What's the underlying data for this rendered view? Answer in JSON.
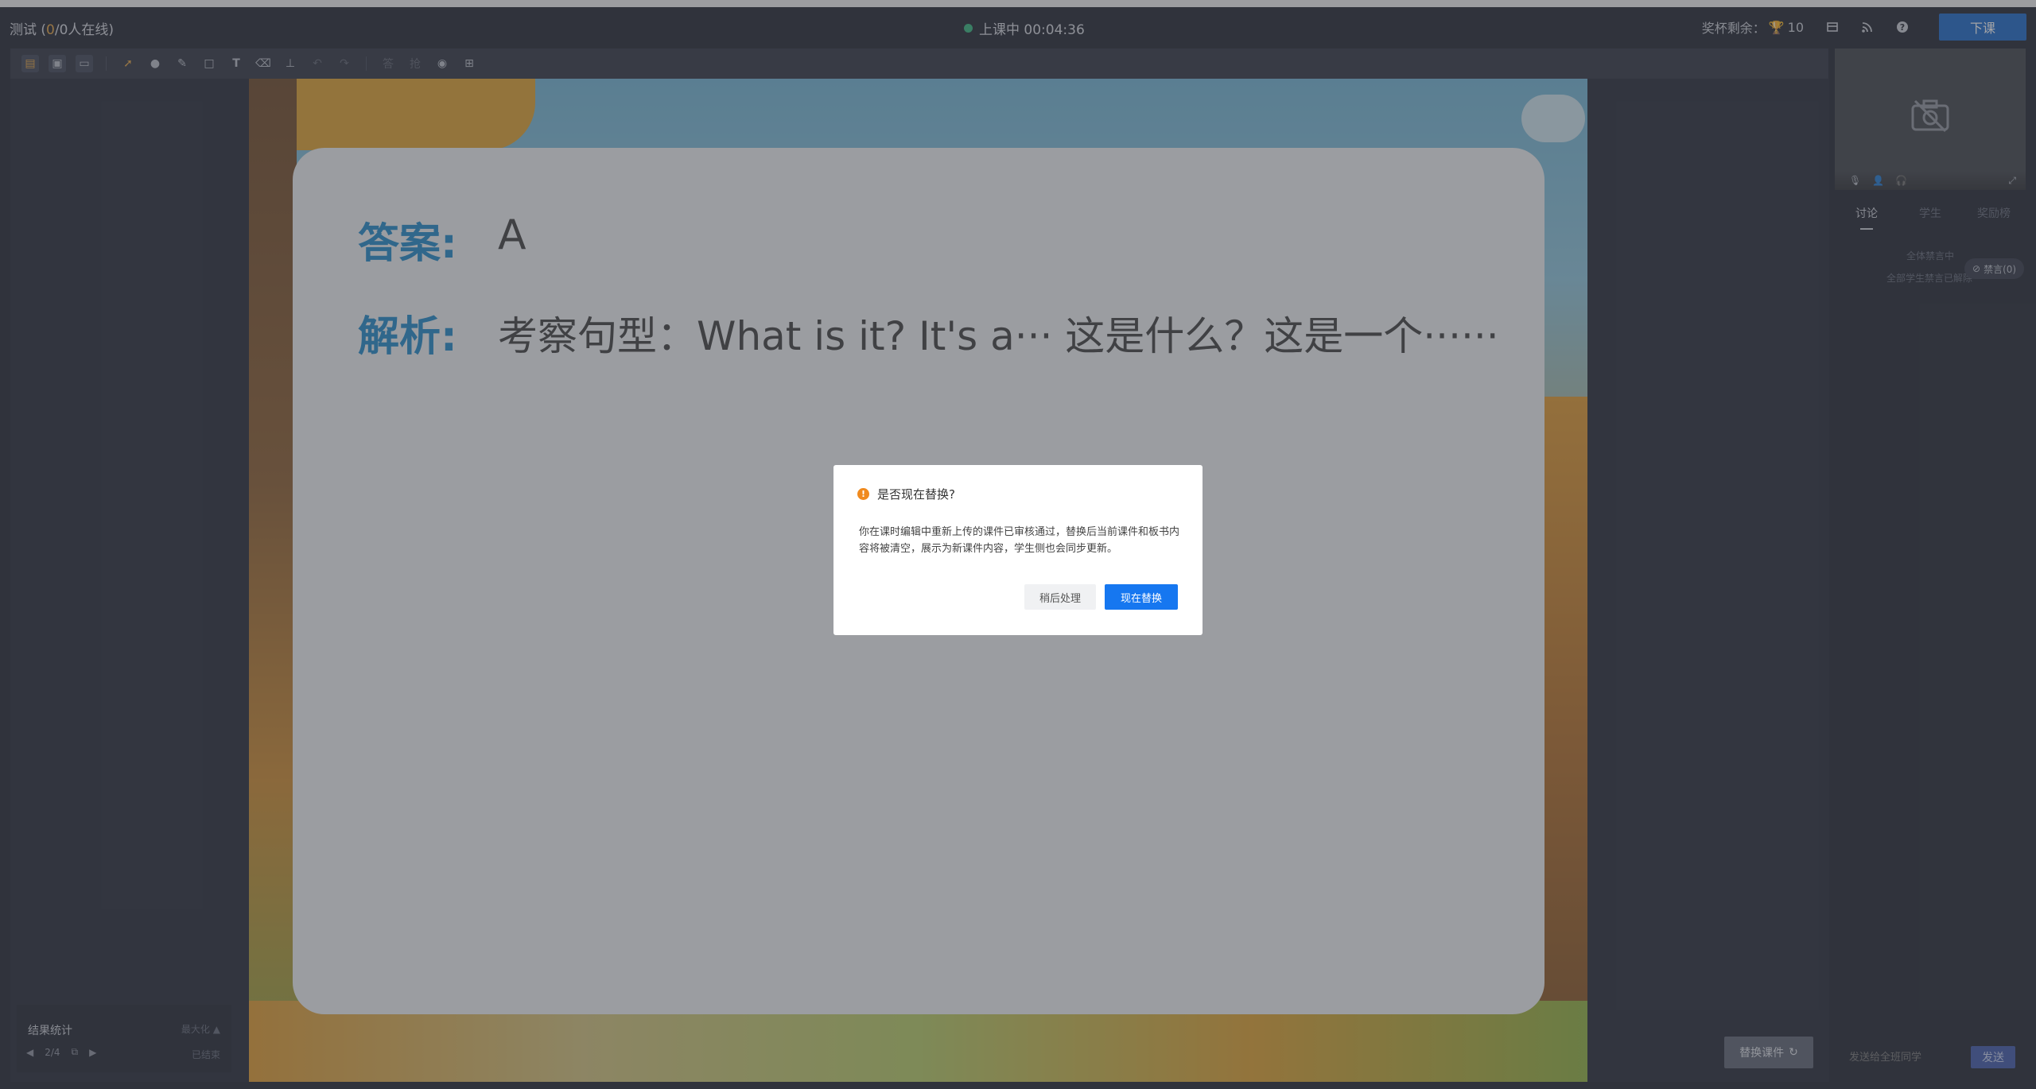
{
  "header": {
    "class_name": "测试",
    "online_prefix": "(",
    "online_count": "0",
    "online_suffix": "/0人在线)",
    "status": "上课中 00:04:36",
    "reward_label": "奖杯剩余：",
    "reward_count": "10",
    "end_button": "下课"
  },
  "toolbar": {
    "icons": [
      "ppt-icon",
      "screen-share-icon",
      "board-icon",
      "cursor-icon",
      "laser-icon",
      "pen-icon",
      "shape-icon",
      "text-icon",
      "eraser-icon",
      "clear-icon",
      "undo-icon",
      "redo-icon",
      "answer-card-icon",
      "random-icon",
      "camera-icon",
      "more-icon"
    ]
  },
  "result_panel": {
    "title": "结果统计",
    "maximize": "最大化",
    "page": "2/4",
    "state": "已结束"
  },
  "slide": {
    "answer_label": "答案:",
    "answer_value": "A",
    "analysis_label": "解析:",
    "analysis_value": "考察句型：What is it? It's a··· 这是什么？这是一个······"
  },
  "replace_button": "替换课件",
  "sidebar": {
    "tabs": [
      "讨论",
      "学生",
      "奖励榜"
    ],
    "mute_all": "全体禁言中",
    "mute_note": "全部学生禁言已解除",
    "mute_chip": "禁言(0)",
    "chat_placeholder": "发送给全班同学",
    "send_button": "发送"
  },
  "dialog": {
    "title": "是否现在替换?",
    "body": "你在课时编辑中重新上传的课件已审核通过，替换后当前课件和板书内容将被清空，展示为新课件内容，学生侧也会同步更新。",
    "later_button": "稍后处理",
    "now_button": "现在替换"
  }
}
